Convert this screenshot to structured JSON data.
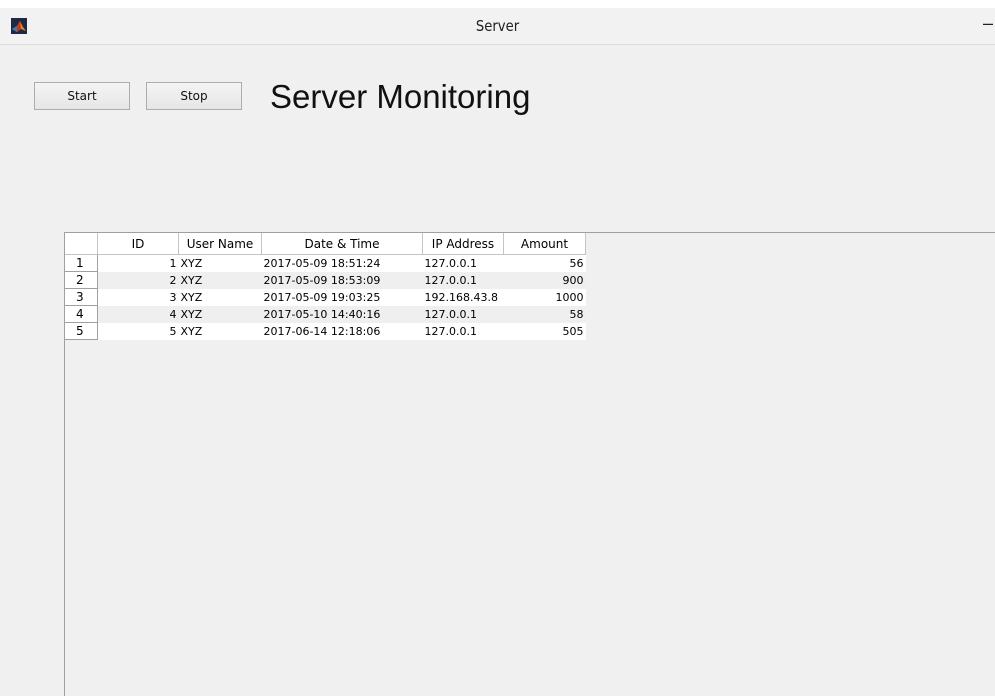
{
  "window": {
    "title": "Server",
    "minimize_glyph": "–"
  },
  "toolbar": {
    "start_label": "Start",
    "stop_label": "Stop"
  },
  "heading": "Server Monitoring",
  "table": {
    "columns": [
      "ID",
      "User Name",
      "Date & Time",
      "IP Address",
      "Amount"
    ],
    "rows": [
      {
        "row_num": "1",
        "id": "1",
        "user": "XYZ",
        "datetime": "2017-05-09 18:51:24",
        "ip": "127.0.0.1",
        "amount": "56"
      },
      {
        "row_num": "2",
        "id": "2",
        "user": "XYZ",
        "datetime": "2017-05-09 18:53:09",
        "ip": "127.0.0.1",
        "amount": "900"
      },
      {
        "row_num": "3",
        "id": "3",
        "user": "XYZ",
        "datetime": "2017-05-09 19:03:25",
        "ip": "192.168.43.8",
        "amount": "1000"
      },
      {
        "row_num": "4",
        "id": "4",
        "user": "XYZ",
        "datetime": "2017-05-10 14:40:16",
        "ip": "127.0.0.1",
        "amount": "58"
      },
      {
        "row_num": "5",
        "id": "5",
        "user": "XYZ",
        "datetime": "2017-06-14 12:18:06",
        "ip": "127.0.0.1",
        "amount": "505"
      }
    ]
  },
  "icons": {
    "app": "matlab-icon",
    "minimize": "minimize-icon"
  }
}
